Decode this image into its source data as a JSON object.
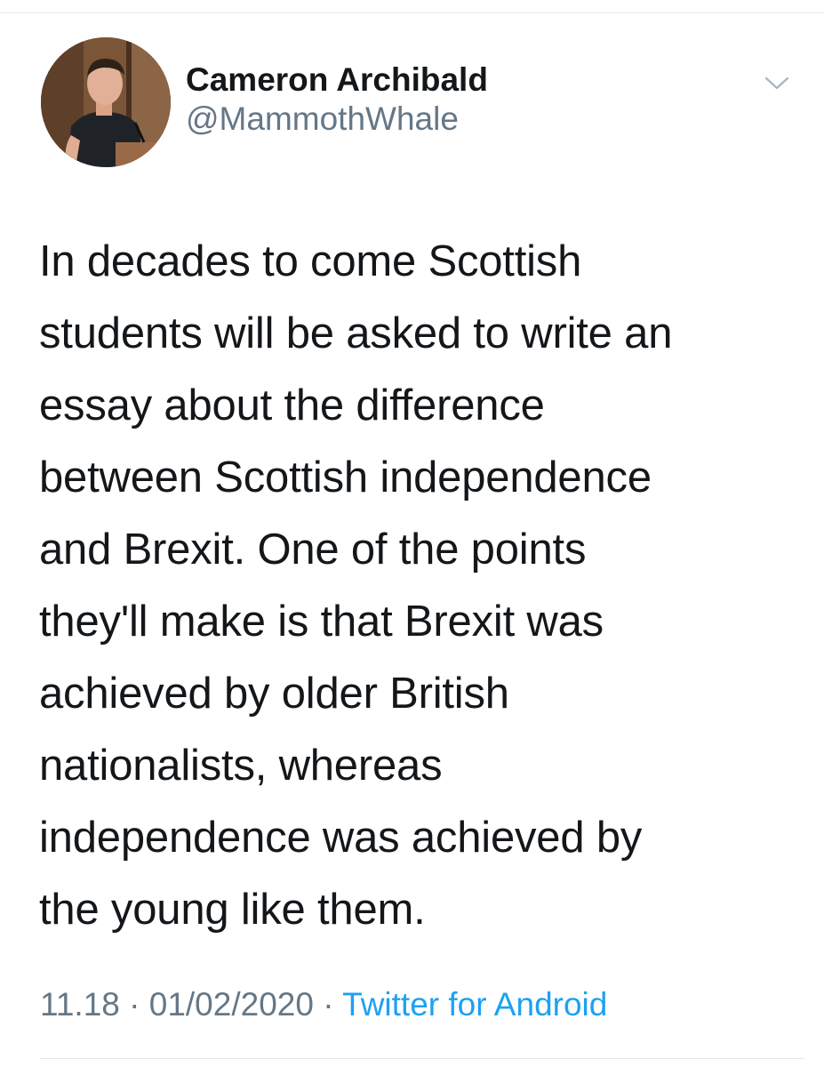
{
  "tweet": {
    "author": {
      "display_name": "Cameron Archibald",
      "handle": "@MammothWhale",
      "avatar_icon": "user-avatar-photo"
    },
    "text": "In decades to come Scottish\nstudents will be asked to write an\nessay about the difference\nbetween Scottish independence\nand Brexit. One of the points\nthey'll make is that Brexit was\nachieved by older British\nnationalists, whereas\nindependence was achieved by\nthe young like them.",
    "time": "11.18",
    "separator": " · ",
    "date": "01/02/2020",
    "source": "Twitter for Android"
  },
  "colors": {
    "text_primary": "#14171a",
    "text_secondary": "#657786",
    "link": "#1da1f2",
    "divider": "#e1e8ed"
  },
  "icons": {
    "more": "chevron-down-icon"
  }
}
